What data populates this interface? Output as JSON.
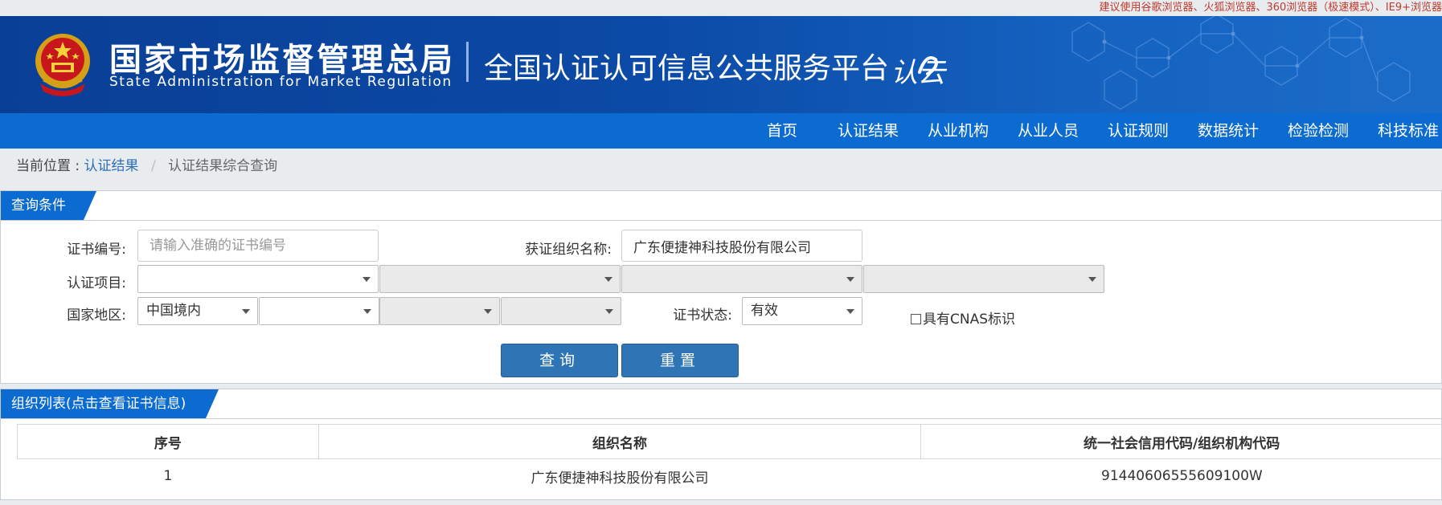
{
  "top_notice": "建议使用谷歌浏览器、火狐浏览器、360浏览器（极速模式）、IE9+浏览器",
  "header": {
    "agency_cn": "国家市场监督管理总局",
    "agency_en": "State Administration  for  Market Regulation",
    "platform_title": "全国认证认可信息公共服务平台",
    "logo_text": "认云"
  },
  "nav": [
    "首页",
    "认证结果",
    "从业机构",
    "从业人员",
    "认证规则",
    "数据统计",
    "检验检测",
    "科技标准"
  ],
  "breadcrumb": {
    "prefix": "当前位置 :",
    "link": "认证结果",
    "separator": "/",
    "current": "认证结果综合查询"
  },
  "query_panel": {
    "title": "查询条件",
    "cert_no_label": "证书编号:",
    "cert_no_placeholder": "请输入准确的证书编号",
    "org_name_label": "获证组织名称:",
    "org_name_value": "广东便捷神科技股份有限公司",
    "project_label": "认证项目:",
    "region_label": "国家地区:",
    "region_value": "中国境内",
    "status_label": "证书状态:",
    "status_value": "有效",
    "cnas_label": "具有CNAS标识",
    "search_button": "查询",
    "reset_button": "重置"
  },
  "list_panel": {
    "title": "组织列表(点击查看证书信息)",
    "columns": [
      "序号",
      "组织名称",
      "统一社会信用代码/组织机构代码"
    ],
    "rows": [
      [
        "1",
        "广东便捷神科技股份有限公司",
        "9144060655560910​0W"
      ]
    ]
  }
}
